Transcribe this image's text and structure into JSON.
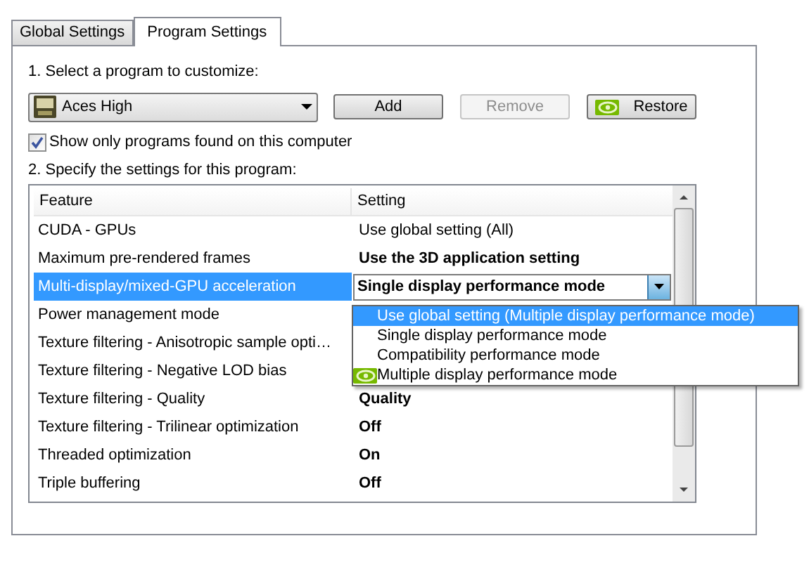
{
  "tabs": [
    {
      "label": "Global Settings",
      "selected": false
    },
    {
      "label": "Program Settings",
      "selected": true
    }
  ],
  "program_section": {
    "label": "1. Select a program to customize:",
    "program": "Aces High",
    "buttons": [
      {
        "label": "Add",
        "disabled": false,
        "kind": "plain"
      },
      {
        "label": "Remove",
        "disabled": true,
        "kind": "plain"
      },
      {
        "label": "Restore",
        "disabled": false,
        "kind": "icon"
      }
    ],
    "checkbox": {
      "label": "Show only programs found on this computer",
      "checked": true
    }
  },
  "settings_section": {
    "label": "2. Specify the settings for this program:",
    "columns": [
      "Feature",
      "Setting"
    ],
    "rows": [
      {
        "feature": "CUDA - GPUs",
        "setting": "Use global setting (All)",
        "bold": false,
        "selected": false
      },
      {
        "feature": "Maximum pre-rendered frames",
        "setting": "Use the 3D application setting",
        "bold": true,
        "selected": false
      },
      {
        "feature": "Multi-display/mixed-GPU acceleration",
        "selected": true,
        "kind": "dropdown"
      },
      {
        "feature": "Power management mode",
        "selected": false
      },
      {
        "feature": "Texture filtering - Anisotropic sample opti…",
        "selected": false
      },
      {
        "feature": "Texture filtering - Negative LOD bias",
        "selected": false
      },
      {
        "feature": "Texture filtering - Quality",
        "setting": "Quality",
        "bold": true,
        "selected": false
      },
      {
        "feature": "Texture filtering - Trilinear optimization",
        "setting": "Off",
        "bold": true,
        "selected": false
      },
      {
        "feature": "Threaded optimization",
        "setting": "On",
        "bold": true,
        "selected": false
      },
      {
        "feature": "Triple buffering",
        "setting": "Off",
        "bold": true,
        "selected": false
      }
    ],
    "dropdown": {
      "value": "Single display performance mode",
      "options": [
        {
          "label": "Use global setting (Multiple display performance mode)",
          "highlighted": true,
          "recommended": false
        },
        {
          "label": "Single display performance mode",
          "highlighted": false,
          "recommended": false
        },
        {
          "label": "Compatibility performance mode",
          "highlighted": false,
          "recommended": false
        },
        {
          "label": "Multiple display performance mode",
          "highlighted": false,
          "recommended": true
        }
      ]
    }
  }
}
